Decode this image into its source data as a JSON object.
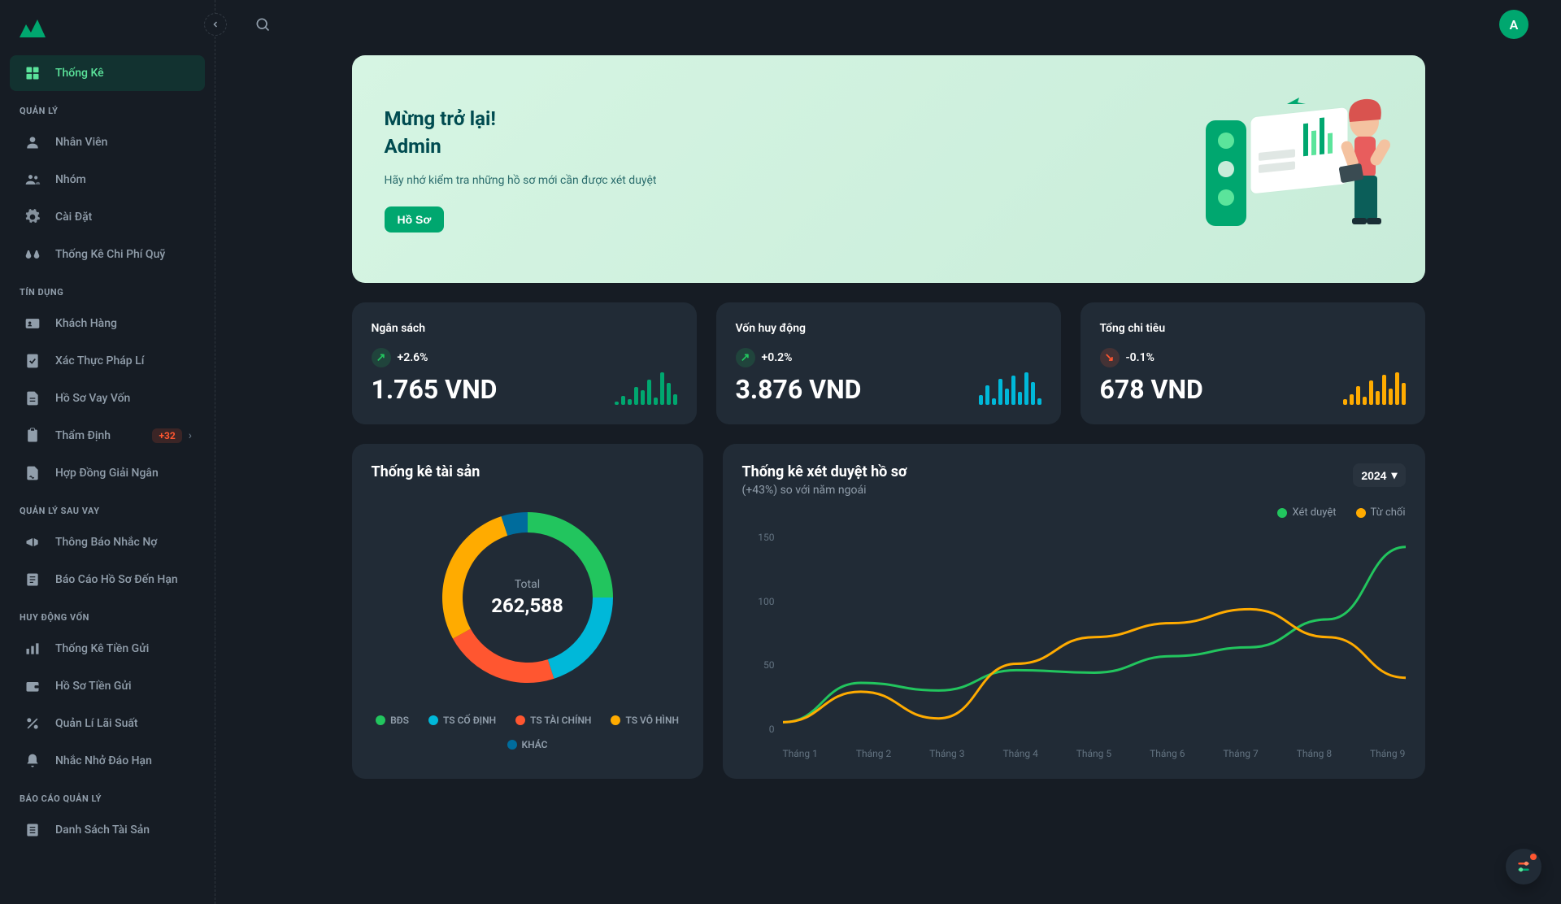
{
  "sidebar": {
    "items": {
      "thongke": "Thống Kê",
      "nhanvien": "Nhân Viên",
      "nhom": "Nhóm",
      "caidat": "Cài Đặt",
      "tkchiphi": "Thống Kê Chi Phí Quỹ",
      "khachhang": "Khách Hàng",
      "xacthuc": "Xác Thực Pháp Lí",
      "hosovay": "Hồ Sơ Vay Vốn",
      "thamdinh": "Thẩm Định",
      "thamdinh_badge": "+32",
      "hopdong": "Hợp Đồng Giải Ngân",
      "thongbao": "Thông Báo Nhắc Nợ",
      "baocao": "Báo Cáo Hồ Sơ Đến Hạn",
      "tktiengui": "Thống Kê Tiền Gửi",
      "hstiengui": "Hồ Sơ Tiền Gửi",
      "qllaisuat": "Quản Lí Lãi Suất",
      "nhacnho": "Nhắc Nhở Đáo Hạn",
      "dsts": "Danh Sách Tài Sản"
    },
    "sections": {
      "quanly": "QUẢN LÝ",
      "tindung": "TÍN DỤNG",
      "quanlysauvay": "QUẢN LÝ SAU VAY",
      "huydongvon": "HUY ĐỘNG VỐN",
      "baocaoql": "BÁO CÁO QUẢN LÝ"
    }
  },
  "header": {
    "avatar": "A"
  },
  "welcome": {
    "line1": "Mừng trở lại!",
    "line2": "Admin",
    "sub": "Hãy nhớ kiểm tra những hồ sơ mới cần được xét duyệt",
    "button": "Hồ Sơ"
  },
  "stats": {
    "budget": {
      "title": "Ngân sách",
      "change": "+2.6%",
      "dir": "up",
      "value": "1.765 VND",
      "color": "#00A76F"
    },
    "funding": {
      "title": "Vốn huy động",
      "change": "+0.2%",
      "dir": "up",
      "value": "3.876 VND",
      "color": "#00B8D9"
    },
    "spending": {
      "title": "Tổng chi tiêu",
      "change": "-0.1%",
      "dir": "down",
      "value": "678 VND",
      "color": "#FFAB00"
    }
  },
  "donut": {
    "title": "Thống kê tài sản",
    "total_label": "Total",
    "total_value": "262,588"
  },
  "line": {
    "title": "Thống kê xét duyệt hồ sơ",
    "sub": "(+43%) so với năm ngoái",
    "year": "2024",
    "legend": {
      "approved": "Xét duyệt",
      "rejected": "Từ chối"
    },
    "yticks": {
      "t0": "0",
      "t50": "50",
      "t100": "100",
      "t150": "150"
    }
  },
  "chart_data": [
    {
      "type": "pie",
      "title": "Thống kê tài sản",
      "total": 262588,
      "series": [
        {
          "name": "BĐS",
          "value": 65647,
          "color": "#22C55E"
        },
        {
          "name": "TS CỐ ĐỊNH",
          "value": 52518,
          "color": "#00B8D9"
        },
        {
          "name": "TS TÀI CHÍNH",
          "value": 57769,
          "color": "#FF5630"
        },
        {
          "name": "TS VÔ HÌNH",
          "value": 73525,
          "color": "#FFAB00"
        },
        {
          "name": "KHÁC",
          "value": 13129,
          "color": "#006C9C"
        }
      ]
    },
    {
      "type": "line",
      "title": "Thống kê xét duyệt hồ sơ",
      "xlabel": "",
      "ylabel": "",
      "ylim": [
        0,
        160
      ],
      "categories": [
        "Tháng 1",
        "Tháng 2",
        "Tháng 3",
        "Tháng 4",
        "Tháng 5",
        "Tháng 6",
        "Tháng 7",
        "Tháng 8",
        "Tháng 9"
      ],
      "series": [
        {
          "name": "Xét duyệt",
          "color": "#22C55E",
          "values": [
            10,
            41,
            35,
            51,
            49,
            62,
            69,
            91,
            148
          ]
        },
        {
          "name": "Từ chối",
          "color": "#FFAB00",
          "values": [
            10,
            34,
            13,
            56,
            77,
            88,
            99,
            77,
            45
          ]
        }
      ]
    },
    {
      "type": "bar",
      "title": "Ngân sách sparkline",
      "categories": [
        1,
        2,
        3,
        4,
        5,
        6,
        7,
        8,
        9,
        10
      ],
      "values": [
        2,
        5,
        3,
        10,
        8,
        14,
        4,
        18,
        12,
        6
      ],
      "color": "#00A76F"
    },
    {
      "type": "bar",
      "title": "Vốn huy động sparkline",
      "categories": [
        1,
        2,
        3,
        4,
        5,
        6,
        7,
        8,
        9,
        10
      ],
      "values": [
        6,
        12,
        4,
        16,
        10,
        18,
        8,
        20,
        14,
        4
      ],
      "color": "#00B8D9"
    },
    {
      "type": "bar",
      "title": "Tổng chi tiêu sparkline",
      "categories": [
        1,
        2,
        3,
        4,
        5,
        6,
        7,
        8,
        9,
        10
      ],
      "values": [
        4,
        8,
        14,
        6,
        18,
        10,
        22,
        12,
        24,
        16
      ],
      "color": "#FFAB00"
    }
  ]
}
